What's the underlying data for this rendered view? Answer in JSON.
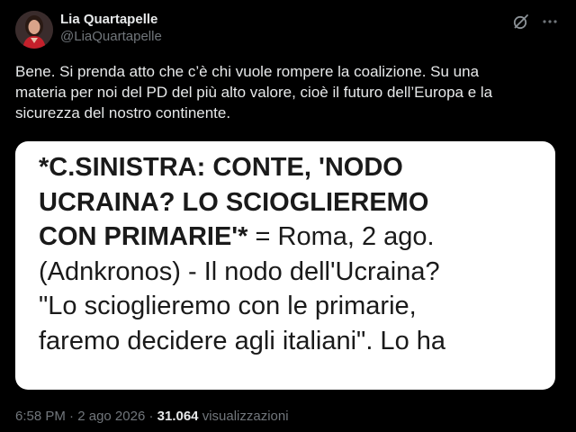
{
  "author": {
    "display_name": "Lia Quartapelle",
    "handle": "@LiaQuartapelle"
  },
  "icons": {
    "grok": "grok-slash-circle-icon",
    "more": "more-dots-icon"
  },
  "post": {
    "text_line1": "Bene. Si prenda atto che c’è chi vuole rompere la coalizione. Su una",
    "text_line2": "materia per noi del PD del più alto valore, cioè il futuro dell’Europa e la",
    "text_line3": "sicurezza del nostro continente."
  },
  "media": {
    "line1": "*C.SINISTRA: CONTE, 'NODO",
    "line2": "UCRAINA? LO SCIOGLIEREMO",
    "line3_bold": "CON PRIMARIE'*",
    "line3_rest": " = Roma, 2 ago.",
    "line4": "(Adnkronos) - Il nodo dell'Ucraina?",
    "line5": "\"Lo scioglieremo con le primarie,",
    "line6": "faremo decidere agli italiani\". Lo ha"
  },
  "meta": {
    "time": "6:58 PM",
    "sep1": " · ",
    "date": "2 ago 2026",
    "sep2": " · ",
    "views_count": "31.064",
    "views_label": " visualizzazioni"
  },
  "colors": {
    "background": "#000000",
    "text_primary": "#e7e9ea",
    "text_secondary": "#71767b",
    "media_bg": "#ffffff"
  }
}
